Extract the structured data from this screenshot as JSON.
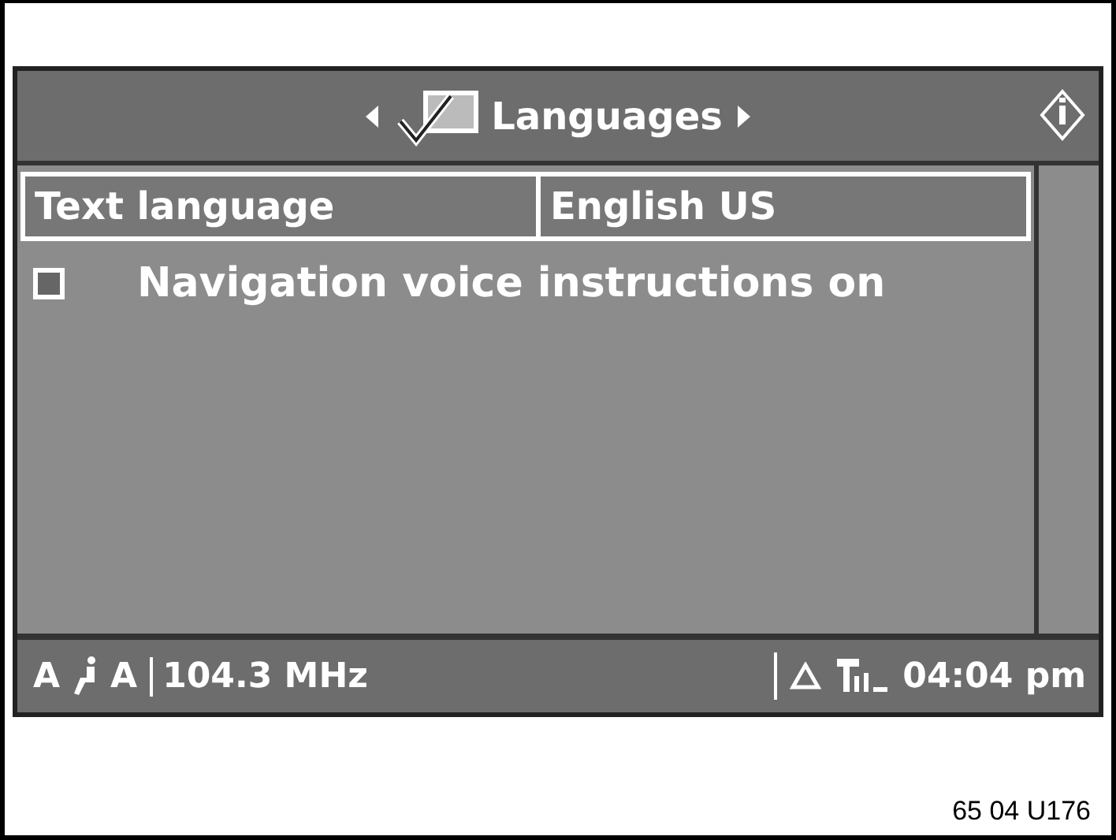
{
  "header": {
    "title": "Languages"
  },
  "setting_row": {
    "label": "Text language",
    "value": "English US",
    "selected": true
  },
  "options": [
    {
      "label": "Navigation voice instructions on",
      "checked": false
    }
  ],
  "status_bar": {
    "left_mode": "A",
    "right_mode": "A",
    "frequency": "104.3 MHz",
    "time": "04:04 pm"
  },
  "caption": "65 04 U176"
}
